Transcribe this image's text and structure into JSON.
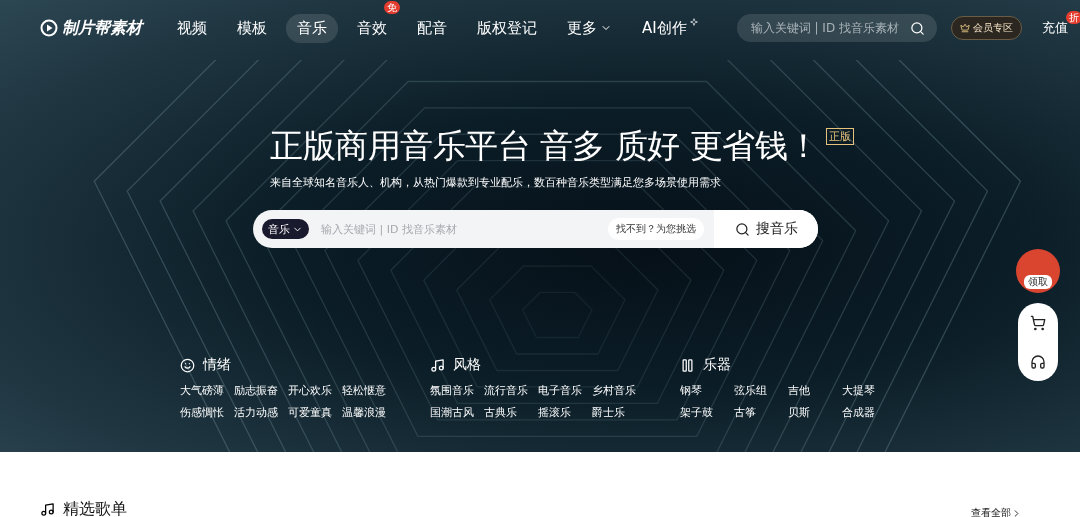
{
  "nav": {
    "logo": "制片帮素材",
    "items": [
      {
        "label": "视频",
        "selected": false,
        "kind": "plain"
      },
      {
        "label": "模板",
        "selected": false,
        "kind": "plain"
      },
      {
        "label": "音乐",
        "selected": true,
        "kind": "plain"
      },
      {
        "label": "音效",
        "selected": false,
        "kind": "plain",
        "badge": "免"
      },
      {
        "label": "配音",
        "selected": false,
        "kind": "plain"
      },
      {
        "label": "版权登记",
        "selected": false,
        "kind": "plain"
      },
      {
        "label": "更多",
        "selected": false,
        "kind": "menu"
      },
      {
        "label": "AI创作",
        "selected": false,
        "kind": "ai"
      }
    ],
    "search": {
      "placeholder": "输入关键词 | ID 找音乐素材"
    },
    "vip": "会员专区",
    "recharge": {
      "label": "充值",
      "badge": "折"
    }
  },
  "hero": {
    "title": "正版商用音乐平台 音多 质好 更省钱！",
    "tag": "正版",
    "subtitle": "来自全球知名音乐人、机构，从热门爆款到专业配乐，数百种音乐类型满足您多场景使用需求",
    "search": {
      "category": "音乐",
      "placeholder": "输入关键词 | ID 找音乐素材",
      "hint": "找不到？为您挑选",
      "button": "搜音乐"
    },
    "categories": [
      {
        "title": "情绪",
        "kind": "mood",
        "tags": [
          "大气磅薄",
          "励志振奋",
          "开心欢乐",
          "轻松惬意",
          "伤感惆怅",
          "活力动感",
          "可爱童真",
          "温馨浪漫"
        ]
      },
      {
        "title": "风格",
        "kind": "style",
        "tags": [
          "氛围音乐",
          "流行音乐",
          "电子音乐",
          "乡村音乐",
          "国潮古风",
          "古典乐",
          "摇滚乐",
          "爵士乐"
        ]
      },
      {
        "title": "乐器",
        "kind": "instrument",
        "tags": [
          "钢琴",
          "弦乐组",
          "吉他",
          "大提琴",
          "架子鼓",
          "古筝",
          "贝斯",
          "合成器"
        ]
      }
    ]
  },
  "float": {
    "gift": "领取"
  },
  "section": {
    "title": "精选歌单",
    "link": "查看全部"
  }
}
